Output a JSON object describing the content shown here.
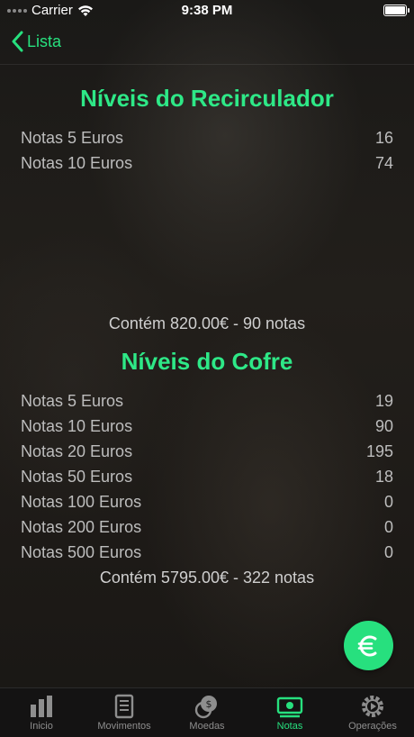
{
  "status_bar": {
    "carrier": "Carrier",
    "time": "9:38 PM"
  },
  "nav": {
    "back_label": "Lista"
  },
  "recirculador": {
    "title": "Níveis do Recirculador",
    "rows": [
      {
        "label": "Notas 5 Euros",
        "value": "16"
      },
      {
        "label": "Notas 10 Euros",
        "value": "74"
      }
    ],
    "summary": "Contém 820.00€ - 90 notas"
  },
  "cofre": {
    "title": "Níveis do Cofre",
    "rows": [
      {
        "label": "Notas 5 Euros",
        "value": "19"
      },
      {
        "label": "Notas 10 Euros",
        "value": "90"
      },
      {
        "label": "Notas 20 Euros",
        "value": "195"
      },
      {
        "label": "Notas 50 Euros",
        "value": "18"
      },
      {
        "label": "Notas 100 Euros",
        "value": "0"
      },
      {
        "label": "Notas 200 Euros",
        "value": "0"
      },
      {
        "label": "Notas 500 Euros",
        "value": "0"
      }
    ],
    "summary": "Contém 5795.00€ - 322 notas"
  },
  "fab": {
    "icon": "euro-icon",
    "symbol": "€"
  },
  "tabs": [
    {
      "label": "Inicio",
      "icon": "bar-chart-icon",
      "active": false
    },
    {
      "label": "Movimentos",
      "icon": "document-list-icon",
      "active": false
    },
    {
      "label": "Moedas",
      "icon": "coins-icon",
      "active": false
    },
    {
      "label": "Notas",
      "icon": "banknote-icon",
      "active": true
    },
    {
      "label": "Operações",
      "icon": "gear-play-icon",
      "active": false
    }
  ],
  "colors": {
    "accent": "#27e07e",
    "inactive": "#8e8e8e"
  }
}
